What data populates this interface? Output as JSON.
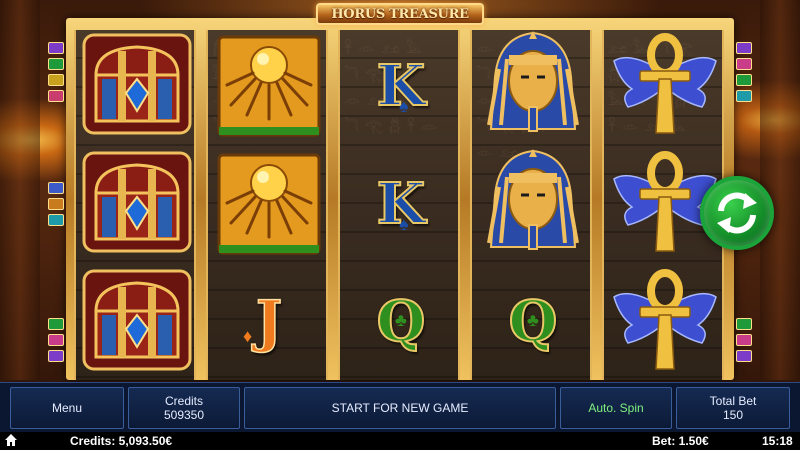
{
  "game": {
    "title": "HORUS TREASURE"
  },
  "reels": [
    [
      "treasure-chest",
      "treasure-chest",
      "treasure-chest"
    ],
    [
      "sun-scarab",
      "sun-scarab",
      "J"
    ],
    [
      "K",
      "K",
      "Q"
    ],
    [
      "pharaoh-mask",
      "pharaoh-mask",
      "Q"
    ],
    [
      "winged-ankh",
      "winged-ankh",
      "winged-ankh"
    ]
  ],
  "letters": {
    "reel3_top": "K",
    "reel3_mid": "K",
    "reel3_bot": "Q",
    "reel2_bot": "J",
    "reel4_bot": "Q"
  },
  "controls": {
    "menu_label": "Menu",
    "credits_label": "Credits",
    "credits_value": "509350",
    "start_label": "START FOR NEW GAME",
    "auto_spin_label": "Auto. Spin",
    "total_bet_label": "Total Bet",
    "total_bet_value": "150"
  },
  "status_bar": {
    "credits": "Credits: 5,093.50€",
    "bet": "Bet: 1.50€",
    "clock": "15:18"
  },
  "icons": {
    "spin": "refresh-arrows-icon",
    "home": "home-icon"
  },
  "colors": {
    "frame_gold": "#e3b55a",
    "control_bg": "#0c1a36",
    "control_border": "#3a5d9c",
    "spin_green": "#1aa43a",
    "auto_spin_text": "#7ff07f"
  }
}
